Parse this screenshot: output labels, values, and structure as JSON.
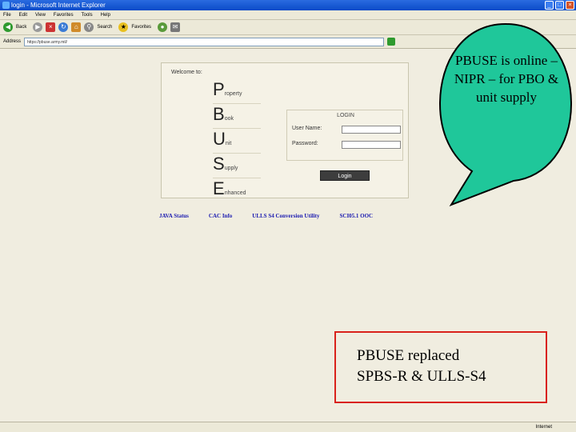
{
  "window": {
    "title": "login - Microsoft Internet Explorer"
  },
  "menu": [
    "File",
    "Edit",
    "View",
    "Favorites",
    "Tools",
    "Help"
  ],
  "toolbar": {
    "back": "Back",
    "search": "Search",
    "favorites": "Favorites"
  },
  "address": {
    "label": "Address",
    "value": "https://pbuse.army.mil/"
  },
  "login": {
    "welcome": "Welcome to:",
    "acronym": [
      {
        "letter": "P",
        "rest": "roperty"
      },
      {
        "letter": "B",
        "rest": "ook"
      },
      {
        "letter": "U",
        "rest": "nit"
      },
      {
        "letter": "S",
        "rest": "upply"
      },
      {
        "letter": "E",
        "rest": "nhanced"
      }
    ],
    "panel_title": "LOGIN",
    "user_label": "User Name:",
    "pass_label": "Password:",
    "button": "Login"
  },
  "links": [
    "JAVA Status",
    "CAC Info",
    "ULLS S4 Conversion Utility",
    "SCI05.1 OOC"
  ],
  "bubble": {
    "text": "PBUSE is online – NIPR – for PBO & unit supply",
    "fill": "#1fc79a"
  },
  "callout": {
    "line1": "PBUSE replaced",
    "line2": "SPBS-R & ULLS-S4",
    "border": "#d9221c"
  },
  "status": {
    "zone": "Internet"
  }
}
